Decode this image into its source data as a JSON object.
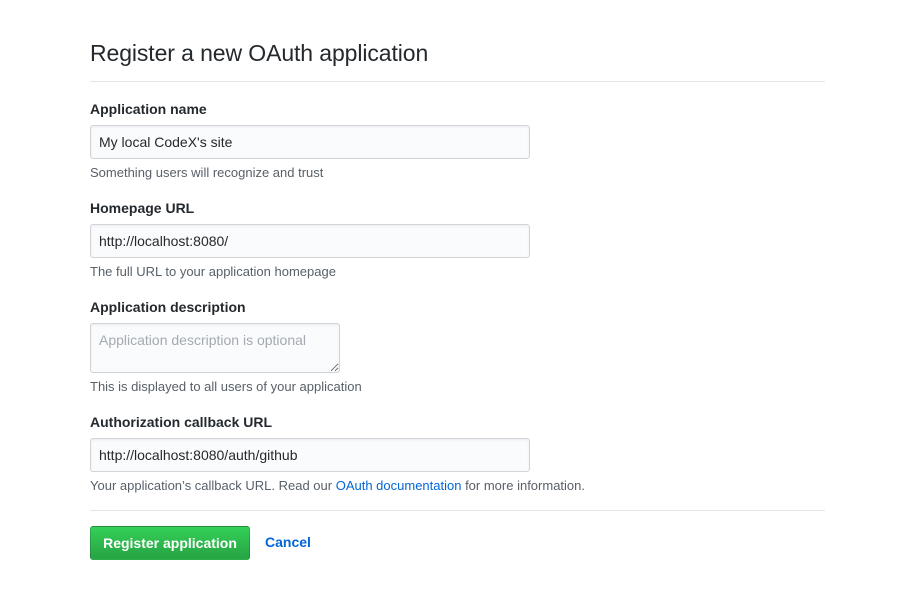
{
  "page": {
    "title": "Register a new OAuth application"
  },
  "form": {
    "app_name": {
      "label": "Application name",
      "value": "My local CodeX's site",
      "note": "Something users will recognize and trust"
    },
    "homepage_url": {
      "label": "Homepage URL",
      "value": "http://localhost:8080/",
      "note": "The full URL to your application homepage"
    },
    "description": {
      "label": "Application description",
      "value": "",
      "placeholder": "Application description is optional",
      "note": "This is displayed to all users of your application"
    },
    "callback_url": {
      "label": "Authorization callback URL",
      "value": "http://localhost:8080/auth/github",
      "note_prefix": "Your application’s callback URL. Read our ",
      "note_link": "OAuth documentation",
      "note_suffix": " for more information."
    }
  },
  "actions": {
    "submit_label": "Register application",
    "cancel_label": "Cancel"
  },
  "colors": {
    "primary_button": "#28a745",
    "link": "#0366d6",
    "text": "#24292e",
    "muted": "#586069",
    "border": "#e1e4e8"
  }
}
